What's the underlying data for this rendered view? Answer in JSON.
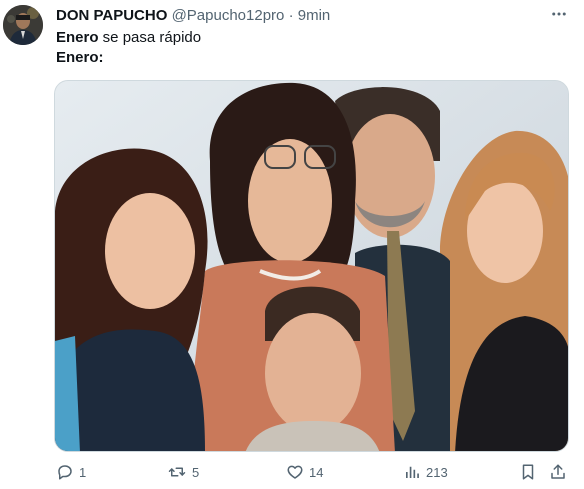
{
  "author": {
    "display_name": "DON PAPUCHO",
    "handle": "@Papucho12pro",
    "separator": "·",
    "time": "9min"
  },
  "tweet": {
    "line1_bold": "Enero",
    "line1_rest": " se pasa rápido",
    "line2_bold": "Enero:"
  },
  "actions": {
    "replies": "1",
    "retweets": "5",
    "likes": "14",
    "views": "213"
  },
  "icons": {
    "more": "more-horizontal-icon",
    "reply": "reply-icon",
    "retweet": "retweet-icon",
    "like": "like-icon",
    "views": "views-icon",
    "bookmark": "bookmark-icon",
    "share": "share-icon"
  },
  "colors": {
    "text": "#0f1419",
    "muted": "#536471",
    "border": "#cfd9de"
  }
}
